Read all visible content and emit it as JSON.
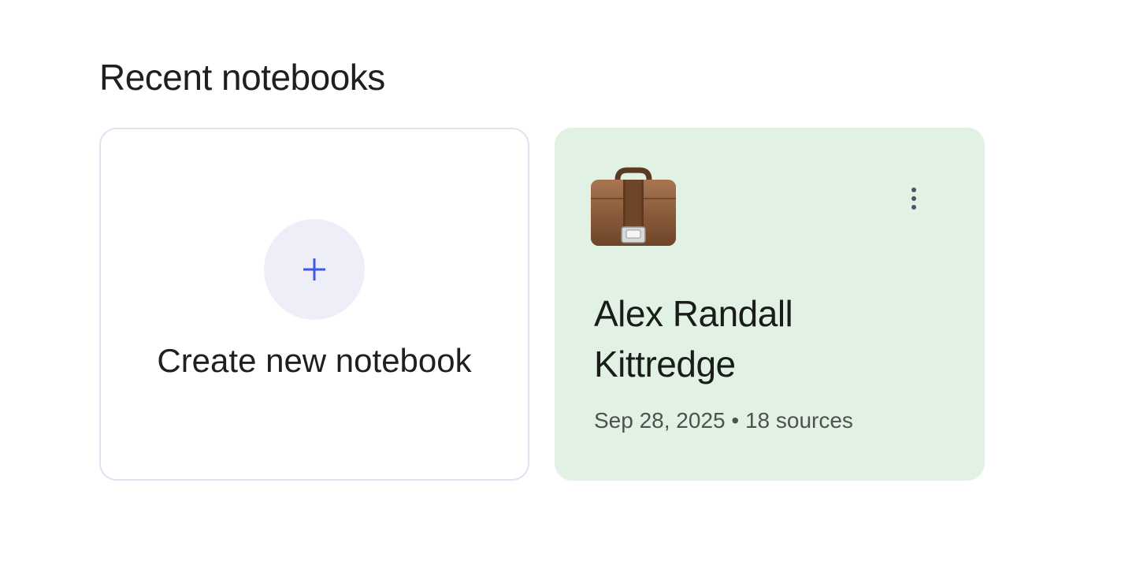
{
  "section": {
    "title": "Recent notebooks"
  },
  "create_card": {
    "label": "Create new notebook",
    "icon": "plus-icon",
    "accent": "#3f5be0"
  },
  "notebooks": [
    {
      "title": "Alex Randall Kittredge",
      "date": "Sep 28, 2025",
      "separator": "•",
      "sources": "18 sources",
      "emoji": "briefcase-icon",
      "background": "#e1f1e3",
      "menu_icon": "more-vertical-icon"
    }
  ]
}
